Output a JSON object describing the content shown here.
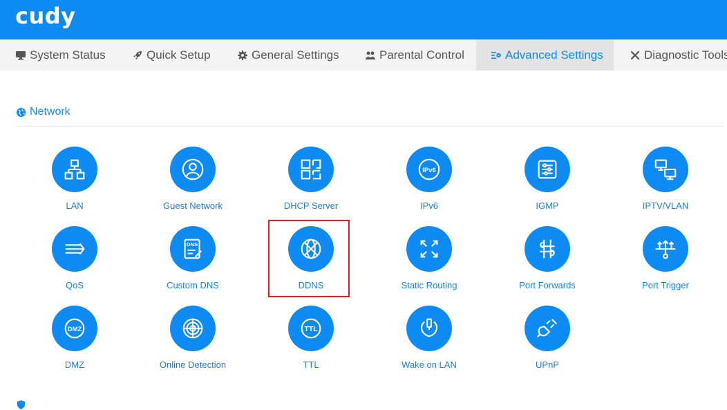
{
  "header": {
    "logo": "cudy"
  },
  "nav": {
    "tabs": [
      {
        "label": "System Status",
        "icon": "monitor-icon"
      },
      {
        "label": "Quick Setup",
        "icon": "rocket-icon"
      },
      {
        "label": "General Settings",
        "icon": "gear-icon"
      },
      {
        "label": "Parental Control",
        "icon": "users-icon"
      },
      {
        "label": "Advanced Settings",
        "icon": "advanced-settings-icon",
        "active": true
      },
      {
        "label": "Diagnostic Tools",
        "icon": "tools-icon"
      }
    ]
  },
  "section": {
    "title": "Network",
    "icon": "globe-icon"
  },
  "tiles": [
    {
      "label": "LAN",
      "icon": "lan-icon"
    },
    {
      "label": "Guest Network",
      "icon": "guest-user-icon"
    },
    {
      "label": "DHCP Server",
      "icon": "dhcp-icon"
    },
    {
      "label": "IPv6",
      "icon": "ipv6-icon",
      "badge": "IPv6"
    },
    {
      "label": "IGMP",
      "icon": "igmp-sliders-icon"
    },
    {
      "label": "IPTV/VLAN",
      "icon": "iptv-monitors-icon"
    },
    {
      "label": "QoS",
      "icon": "qos-arrows-icon"
    },
    {
      "label": "Custom DNS",
      "icon": "custom-dns-icon",
      "badge": "DNS"
    },
    {
      "label": "DDNS",
      "icon": "ddns-globe-icon",
      "highlighted": true
    },
    {
      "label": "Static Routing",
      "icon": "static-routing-icon"
    },
    {
      "label": "Port Forwards",
      "icon": "port-forwards-icon"
    },
    {
      "label": "Port Trigger",
      "icon": "port-trigger-icon"
    },
    {
      "label": "DMZ",
      "icon": "dmz-icon",
      "badge": "DMZ"
    },
    {
      "label": "Online Detection",
      "icon": "online-detection-icon"
    },
    {
      "label": "TTL",
      "icon": "ttl-icon",
      "badge": "TTL"
    },
    {
      "label": "Wake on LAN",
      "icon": "wake-on-lan-icon"
    },
    {
      "label": "UPnP",
      "icon": "upnp-plug-icon"
    }
  ],
  "colors": {
    "brand": "#0d8bf2",
    "highlight": "#d9201f",
    "label": "#1a7fd6"
  }
}
